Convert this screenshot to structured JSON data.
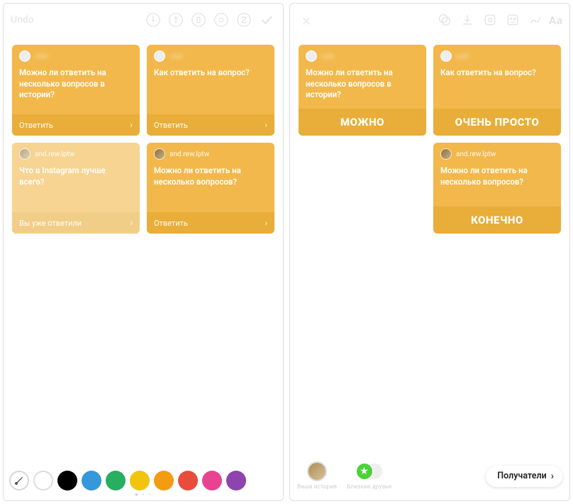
{
  "left": {
    "topbar": {
      "undo": "Undo"
    },
    "cards": [
      {
        "question": "Можно ли ответить на несколько вопросов в истории?",
        "footer": "Ответить"
      },
      {
        "question": "Как ответить на вопрос?",
        "footer": "Ответить"
      },
      {
        "username": "and.rew.lptw",
        "question": "Что в Instagram лучше всего?",
        "footer": "Вы уже ответили"
      },
      {
        "username": "and.rew.lptw",
        "question": "Можно ли ответить на несколько вопросов?",
        "footer": "Ответить"
      }
    ],
    "colors": [
      "#ffffff",
      "#000000",
      "#3498db",
      "#27ae60",
      "#f1c40f",
      "#f39c12",
      "#e74c3c",
      "#e84393",
      "#8e44ad"
    ]
  },
  "right": {
    "cards": [
      {
        "question": "Можно ли ответить на несколько вопросов в истории?",
        "answer": "МОЖНО"
      },
      {
        "question": "Как ответить на вопрос?",
        "answer": "ОЧЕНЬ ПРОСТО"
      },
      {
        "username": "and.rew.lptw",
        "question": "Можно ли ответить на несколько вопросов?",
        "answer": "КОНЕЧНО"
      }
    ],
    "bottom": {
      "your_story": "Ваша история",
      "close_friends": "Близкие друзья",
      "recipients": "Получатели"
    },
    "aa": "Aa"
  }
}
